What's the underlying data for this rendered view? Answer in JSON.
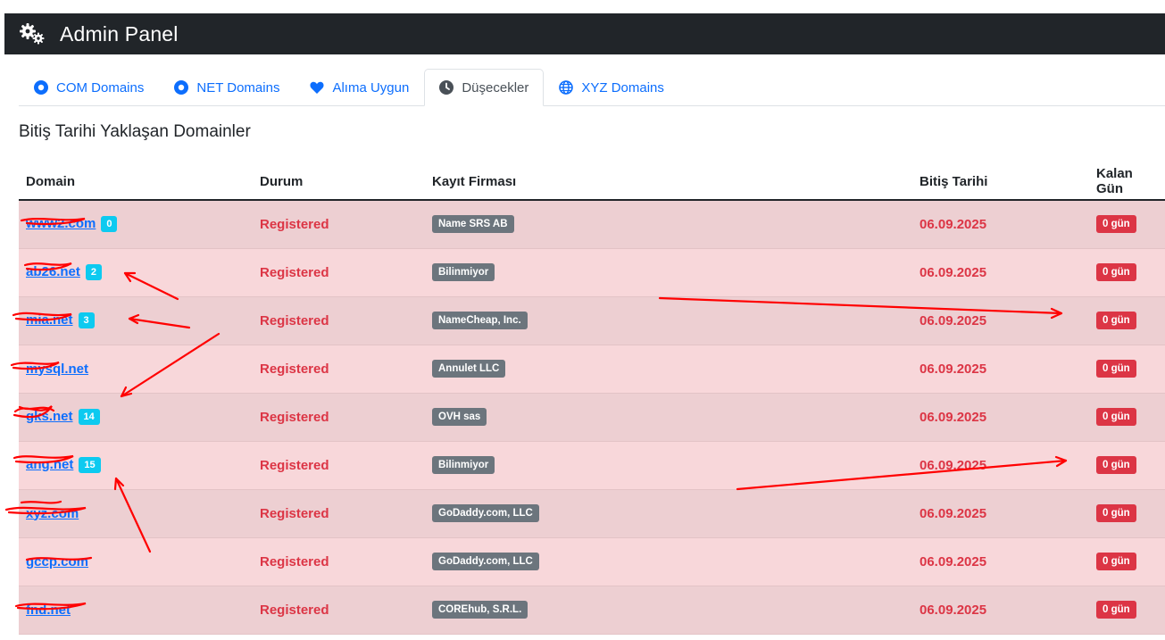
{
  "header": {
    "title": "Admin Panel",
    "icon": "gears-icon"
  },
  "tabs": [
    {
      "label": "COM Domains",
      "icon": "circle-dot-icon",
      "active": false
    },
    {
      "label": "NET Domains",
      "icon": "circle-dot-icon",
      "active": false
    },
    {
      "label": "Alıma Uygun",
      "icon": "heart-icon",
      "active": false
    },
    {
      "label": "Düşecekler",
      "icon": "clock-icon",
      "active": true
    },
    {
      "label": "XYZ Domains",
      "icon": "globe-icon",
      "active": false
    }
  ],
  "section": {
    "title": "Bitiş Tarihi Yaklaşan Domainler"
  },
  "table": {
    "headers": [
      "Domain",
      "Durum",
      "Kayıt Firması",
      "Bitiş Tarihi",
      "Kalan Gün"
    ],
    "rows": [
      {
        "domain": "www2.com",
        "count": "0",
        "status": "Registered",
        "registrar": "Name SRS AB",
        "date": "06.09.2025",
        "days": "0 gün"
      },
      {
        "domain": "ab26.net",
        "count": "2",
        "status": "Registered",
        "registrar": "Bilinmiyor",
        "date": "06.09.2025",
        "days": "0 gün"
      },
      {
        "domain": "mia.net",
        "count": "3",
        "status": "Registered",
        "registrar": "NameCheap, Inc.",
        "date": "06.09.2025",
        "days": "0 gün"
      },
      {
        "domain": "mysql.net",
        "count": "",
        "status": "Registered",
        "registrar": "Annulet LLC",
        "date": "06.09.2025",
        "days": "0 gün"
      },
      {
        "domain": "gks.net",
        "count": "14",
        "status": "Registered",
        "registrar": "OVH sas",
        "date": "06.09.2025",
        "days": "0 gün"
      },
      {
        "domain": "ang.net",
        "count": "15",
        "status": "Registered",
        "registrar": "Bilinmiyor",
        "date": "06.09.2025",
        "days": "0 gün"
      },
      {
        "domain": "xyz.com",
        "count": "",
        "status": "Registered",
        "registrar": "GoDaddy.com, LLC",
        "date": "06.09.2025",
        "days": "0 gün"
      },
      {
        "domain": "gccp.com",
        "count": "",
        "status": "Registered",
        "registrar": "GoDaddy.com, LLC",
        "date": "06.09.2025",
        "days": "0 gün"
      },
      {
        "domain": "fnd.net",
        "count": "",
        "status": "Registered",
        "registrar": "COREhub, S.R.L.",
        "date": "06.09.2025",
        "days": "0 gün"
      }
    ]
  },
  "colors": {
    "navbar": "#212529",
    "link": "#0d6efd",
    "danger": "#dc3545",
    "info": "#0dcaf0",
    "secondary": "#6c757d",
    "row_odd": "#edcfd2",
    "row_even": "#f8d7da",
    "annotation": "#ff0000"
  }
}
